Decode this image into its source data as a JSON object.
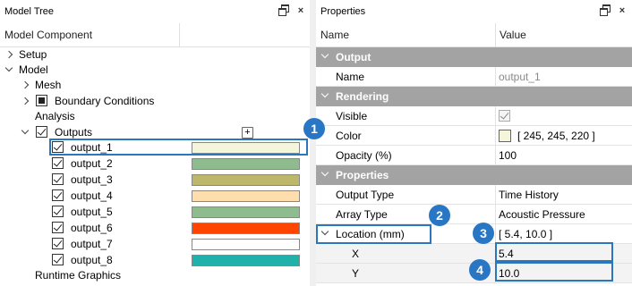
{
  "tree_panel": {
    "title": "Model Tree",
    "column_header": "Model Component",
    "items": [
      {
        "label": "Setup"
      },
      {
        "label": "Model"
      },
      {
        "label": "Mesh"
      },
      {
        "label": "Boundary Conditions"
      },
      {
        "label": "Analysis"
      },
      {
        "label": "Outputs"
      },
      {
        "label": "output_1",
        "color": "#f5f5dc"
      },
      {
        "label": "output_2",
        "color": "#8fbc8f"
      },
      {
        "label": "output_3",
        "color": "#bdb76b"
      },
      {
        "label": "output_4",
        "color": "#ffdead"
      },
      {
        "label": "output_5",
        "color": "#8fbc8f"
      },
      {
        "label": "output_6",
        "color": "#ff4500"
      },
      {
        "label": "output_7",
        "color": "#ffffff"
      },
      {
        "label": "output_8",
        "color": "#20b2aa"
      },
      {
        "label": "Runtime Graphics"
      }
    ],
    "add_button_label": "+"
  },
  "props_panel": {
    "title": "Properties",
    "col_name": "Name",
    "col_value": "Value",
    "sections": {
      "output": "Output",
      "rendering": "Rendering",
      "properties": "Properties"
    },
    "rows": {
      "name": {
        "label": "Name",
        "value": "output_1"
      },
      "visible": {
        "label": "Visible"
      },
      "color": {
        "label": "Color",
        "value": "[ 245, 245, 220 ]",
        "swatch": "#f5f5dc"
      },
      "opacity": {
        "label": "Opacity (%)",
        "value": "100"
      },
      "output_type": {
        "label": "Output Type",
        "value": "Time History"
      },
      "array_type": {
        "label": "Array Type",
        "value": "Acoustic Pressure"
      },
      "location": {
        "label": "Location (mm)",
        "value": "[ 5.4, 10.0 ]"
      },
      "x": {
        "label": "X",
        "value": "5.4"
      },
      "y": {
        "label": "Y",
        "value": "10.0"
      }
    }
  },
  "callouts": [
    "1",
    "2",
    "3",
    "4"
  ],
  "colors": {
    "accent": "#2876c4",
    "section_bg": "#a3a3a3"
  }
}
